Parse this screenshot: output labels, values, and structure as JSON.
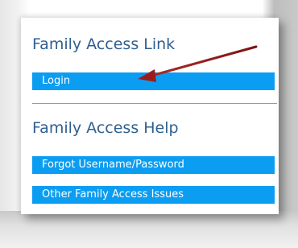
{
  "family_access_link": {
    "heading": "Family Access Link",
    "login_label": "Login"
  },
  "family_access_help": {
    "heading": "Family Access Help",
    "forgot_label": "Forgot Username/Password",
    "other_issues_label": "Other Family Access Issues"
  },
  "colors": {
    "button_blue": "#0a9df2",
    "heading_blue": "#2f5f8f",
    "arrow_red": "#9b1c1c"
  }
}
